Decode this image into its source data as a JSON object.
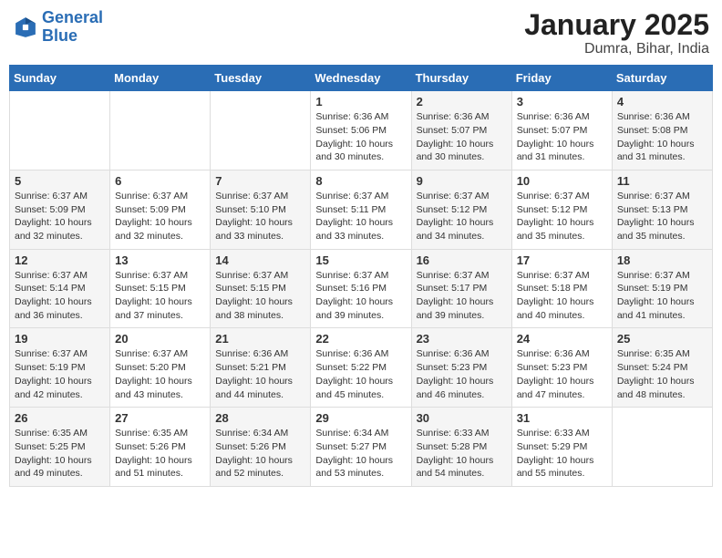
{
  "header": {
    "logo_line1": "General",
    "logo_line2": "Blue",
    "month": "January 2025",
    "location": "Dumra, Bihar, India"
  },
  "weekdays": [
    "Sunday",
    "Monday",
    "Tuesday",
    "Wednesday",
    "Thursday",
    "Friday",
    "Saturday"
  ],
  "weeks": [
    [
      {
        "day": "",
        "sunrise": "",
        "sunset": "",
        "daylight": ""
      },
      {
        "day": "",
        "sunrise": "",
        "sunset": "",
        "daylight": ""
      },
      {
        "day": "",
        "sunrise": "",
        "sunset": "",
        "daylight": ""
      },
      {
        "day": "1",
        "sunrise": "Sunrise: 6:36 AM",
        "sunset": "Sunset: 5:06 PM",
        "daylight": "Daylight: 10 hours and 30 minutes."
      },
      {
        "day": "2",
        "sunrise": "Sunrise: 6:36 AM",
        "sunset": "Sunset: 5:07 PM",
        "daylight": "Daylight: 10 hours and 30 minutes."
      },
      {
        "day": "3",
        "sunrise": "Sunrise: 6:36 AM",
        "sunset": "Sunset: 5:07 PM",
        "daylight": "Daylight: 10 hours and 31 minutes."
      },
      {
        "day": "4",
        "sunrise": "Sunrise: 6:36 AM",
        "sunset": "Sunset: 5:08 PM",
        "daylight": "Daylight: 10 hours and 31 minutes."
      }
    ],
    [
      {
        "day": "5",
        "sunrise": "Sunrise: 6:37 AM",
        "sunset": "Sunset: 5:09 PM",
        "daylight": "Daylight: 10 hours and 32 minutes."
      },
      {
        "day": "6",
        "sunrise": "Sunrise: 6:37 AM",
        "sunset": "Sunset: 5:09 PM",
        "daylight": "Daylight: 10 hours and 32 minutes."
      },
      {
        "day": "7",
        "sunrise": "Sunrise: 6:37 AM",
        "sunset": "Sunset: 5:10 PM",
        "daylight": "Daylight: 10 hours and 33 minutes."
      },
      {
        "day": "8",
        "sunrise": "Sunrise: 6:37 AM",
        "sunset": "Sunset: 5:11 PM",
        "daylight": "Daylight: 10 hours and 33 minutes."
      },
      {
        "day": "9",
        "sunrise": "Sunrise: 6:37 AM",
        "sunset": "Sunset: 5:12 PM",
        "daylight": "Daylight: 10 hours and 34 minutes."
      },
      {
        "day": "10",
        "sunrise": "Sunrise: 6:37 AM",
        "sunset": "Sunset: 5:12 PM",
        "daylight": "Daylight: 10 hours and 35 minutes."
      },
      {
        "day": "11",
        "sunrise": "Sunrise: 6:37 AM",
        "sunset": "Sunset: 5:13 PM",
        "daylight": "Daylight: 10 hours and 35 minutes."
      }
    ],
    [
      {
        "day": "12",
        "sunrise": "Sunrise: 6:37 AM",
        "sunset": "Sunset: 5:14 PM",
        "daylight": "Daylight: 10 hours and 36 minutes."
      },
      {
        "day": "13",
        "sunrise": "Sunrise: 6:37 AM",
        "sunset": "Sunset: 5:15 PM",
        "daylight": "Daylight: 10 hours and 37 minutes."
      },
      {
        "day": "14",
        "sunrise": "Sunrise: 6:37 AM",
        "sunset": "Sunset: 5:15 PM",
        "daylight": "Daylight: 10 hours and 38 minutes."
      },
      {
        "day": "15",
        "sunrise": "Sunrise: 6:37 AM",
        "sunset": "Sunset: 5:16 PM",
        "daylight": "Daylight: 10 hours and 39 minutes."
      },
      {
        "day": "16",
        "sunrise": "Sunrise: 6:37 AM",
        "sunset": "Sunset: 5:17 PM",
        "daylight": "Daylight: 10 hours and 39 minutes."
      },
      {
        "day": "17",
        "sunrise": "Sunrise: 6:37 AM",
        "sunset": "Sunset: 5:18 PM",
        "daylight": "Daylight: 10 hours and 40 minutes."
      },
      {
        "day": "18",
        "sunrise": "Sunrise: 6:37 AM",
        "sunset": "Sunset: 5:19 PM",
        "daylight": "Daylight: 10 hours and 41 minutes."
      }
    ],
    [
      {
        "day": "19",
        "sunrise": "Sunrise: 6:37 AM",
        "sunset": "Sunset: 5:19 PM",
        "daylight": "Daylight: 10 hours and 42 minutes."
      },
      {
        "day": "20",
        "sunrise": "Sunrise: 6:37 AM",
        "sunset": "Sunset: 5:20 PM",
        "daylight": "Daylight: 10 hours and 43 minutes."
      },
      {
        "day": "21",
        "sunrise": "Sunrise: 6:36 AM",
        "sunset": "Sunset: 5:21 PM",
        "daylight": "Daylight: 10 hours and 44 minutes."
      },
      {
        "day": "22",
        "sunrise": "Sunrise: 6:36 AM",
        "sunset": "Sunset: 5:22 PM",
        "daylight": "Daylight: 10 hours and 45 minutes."
      },
      {
        "day": "23",
        "sunrise": "Sunrise: 6:36 AM",
        "sunset": "Sunset: 5:23 PM",
        "daylight": "Daylight: 10 hours and 46 minutes."
      },
      {
        "day": "24",
        "sunrise": "Sunrise: 6:36 AM",
        "sunset": "Sunset: 5:23 PM",
        "daylight": "Daylight: 10 hours and 47 minutes."
      },
      {
        "day": "25",
        "sunrise": "Sunrise: 6:35 AM",
        "sunset": "Sunset: 5:24 PM",
        "daylight": "Daylight: 10 hours and 48 minutes."
      }
    ],
    [
      {
        "day": "26",
        "sunrise": "Sunrise: 6:35 AM",
        "sunset": "Sunset: 5:25 PM",
        "daylight": "Daylight: 10 hours and 49 minutes."
      },
      {
        "day": "27",
        "sunrise": "Sunrise: 6:35 AM",
        "sunset": "Sunset: 5:26 PM",
        "daylight": "Daylight: 10 hours and 51 minutes."
      },
      {
        "day": "28",
        "sunrise": "Sunrise: 6:34 AM",
        "sunset": "Sunset: 5:26 PM",
        "daylight": "Daylight: 10 hours and 52 minutes."
      },
      {
        "day": "29",
        "sunrise": "Sunrise: 6:34 AM",
        "sunset": "Sunset: 5:27 PM",
        "daylight": "Daylight: 10 hours and 53 minutes."
      },
      {
        "day": "30",
        "sunrise": "Sunrise: 6:33 AM",
        "sunset": "Sunset: 5:28 PM",
        "daylight": "Daylight: 10 hours and 54 minutes."
      },
      {
        "day": "31",
        "sunrise": "Sunrise: 6:33 AM",
        "sunset": "Sunset: 5:29 PM",
        "daylight": "Daylight: 10 hours and 55 minutes."
      },
      {
        "day": "",
        "sunrise": "",
        "sunset": "",
        "daylight": ""
      }
    ]
  ]
}
